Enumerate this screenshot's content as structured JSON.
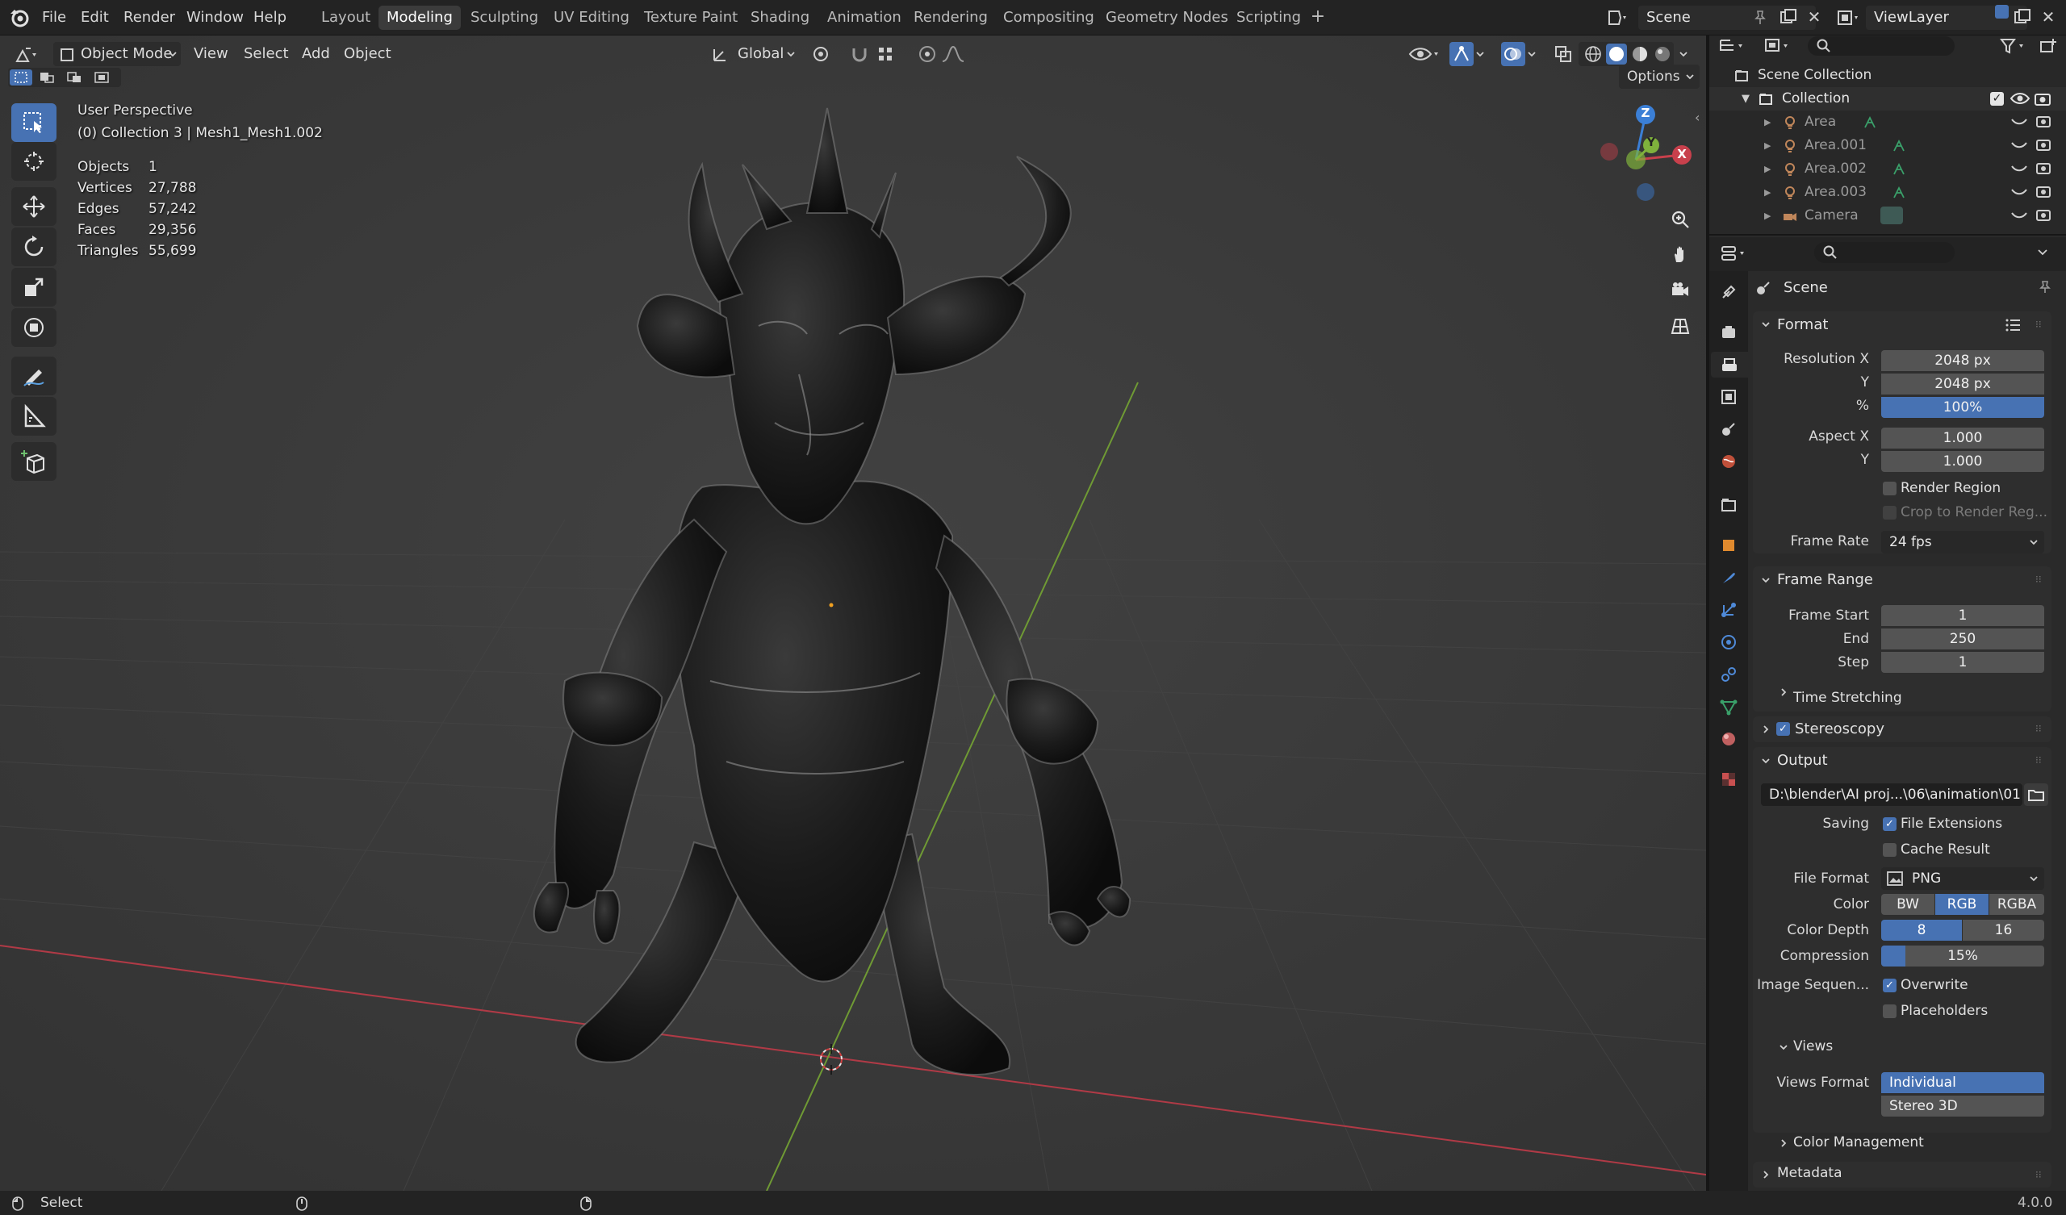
{
  "topbar": {
    "menus": [
      "File",
      "Edit",
      "Render",
      "Window",
      "Help"
    ],
    "workspaces": [
      "Layout",
      "Modeling",
      "Sculpting",
      "UV Editing",
      "Texture Paint",
      "Shading",
      "Animation",
      "Rendering",
      "Compositing",
      "Geometry Nodes",
      "Scripting"
    ],
    "active_workspace": "Modeling",
    "scene": "Scene",
    "view_layer": "ViewLayer"
  },
  "viewport": {
    "mode": "Object Mode",
    "menus": [
      "View",
      "Select",
      "Add",
      "Object"
    ],
    "orientation": "Global",
    "options": "Options",
    "perspective": "User Perspective",
    "collection_line": "(0) Collection 3 | Mesh1_Mesh1.002",
    "stats": [
      {
        "label": "Objects",
        "value": "1"
      },
      {
        "label": "Vertices",
        "value": "27,788"
      },
      {
        "label": "Edges",
        "value": "57,242"
      },
      {
        "label": "Faces",
        "value": "29,356"
      },
      {
        "label": "Triangles",
        "value": "55,699"
      }
    ],
    "gizmo": {
      "z": "Z",
      "y": "Y",
      "x": "X"
    }
  },
  "tools": [
    "select-box-icon",
    "cursor-icon",
    "move-icon",
    "rotate-icon",
    "scale-icon",
    "transform-icon",
    "annotate-icon",
    "measure-icon",
    "add-cube-icon"
  ],
  "outliner": {
    "root": "Scene Collection",
    "collection": "Collection",
    "items": [
      "Area",
      "Area.001",
      "Area.002",
      "Area.003",
      "Camera"
    ]
  },
  "properties": {
    "context": "Scene",
    "format": {
      "title": "Format",
      "res_x_label": "Resolution X",
      "res_x": "2048 px",
      "res_y_label": "Y",
      "res_y": "2048 px",
      "pct_label": "%",
      "pct": "100%",
      "aspect_x_label": "Aspect X",
      "aspect_x": "1.000",
      "aspect_y_label": "Y",
      "aspect_y": "1.000",
      "render_region": "Render Region",
      "crop": "Crop to Render Reg...",
      "frame_rate_label": "Frame Rate",
      "frame_rate": "24 fps"
    },
    "frame_range": {
      "title": "Frame Range",
      "start_label": "Frame Start",
      "start": "1",
      "end_label": "End",
      "end": "250",
      "step_label": "Step",
      "step": "1",
      "time_stretching": "Time Stretching"
    },
    "stereoscopy": "Stereoscopy",
    "output": {
      "title": "Output",
      "path": "D:\\blender\\AI proj...\\06\\animation\\01",
      "saving_label": "Saving",
      "file_extensions": "File Extensions",
      "cache_result": "Cache Result",
      "file_format_label": "File Format",
      "file_format": "PNG",
      "color_label": "Color",
      "color_options": [
        "BW",
        "RGB",
        "RGBA"
      ],
      "color_selected": "RGB",
      "depth_label": "Color Depth",
      "depth_options": [
        "8",
        "16"
      ],
      "depth_selected": "8",
      "compression_label": "Compression",
      "compression": "15%",
      "compression_value": 0.15,
      "image_seq_label": "Image Sequen...",
      "overwrite": "Overwrite",
      "placeholders": "Placeholders"
    },
    "views": {
      "title": "Views",
      "format_label": "Views Format",
      "options": [
        "Individual",
        "Stereo 3D"
      ],
      "selected": "Individual"
    },
    "color_management": "Color Management",
    "metadata": "Metadata"
  },
  "status": {
    "select": "Select",
    "version": "4.0.0"
  },
  "colors": {
    "accent": "#4772b3",
    "viewport_bg": "#3a3a3a",
    "x_axis": "#c8404c",
    "y_axis": "#7fb13c",
    "z_axis": "#3b7fd6"
  }
}
